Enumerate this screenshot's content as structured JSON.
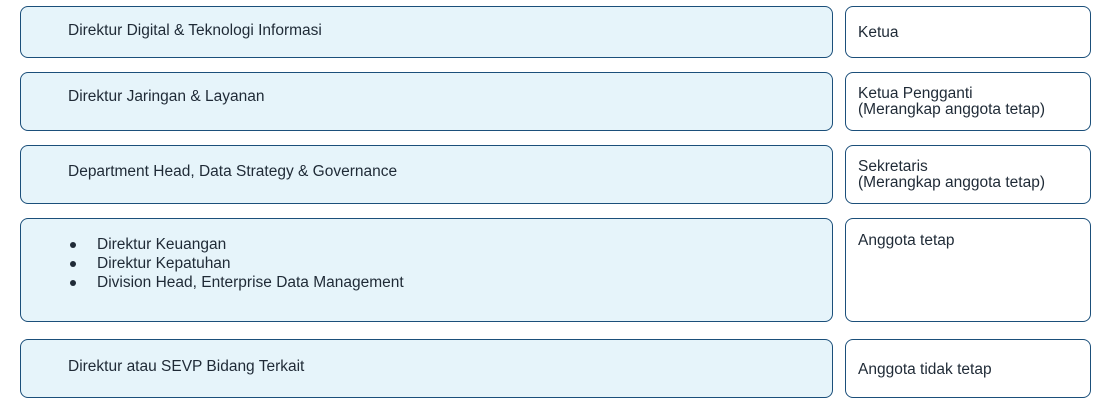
{
  "rows": [
    {
      "member": "Direktur Digital & Teknologi Informasi",
      "role_line1": "Ketua",
      "role_line2": ""
    },
    {
      "member": "Direktur Jaringan & Layanan",
      "role_line1": "Ketua Pengganti",
      "role_line2": "(Merangkap anggota tetap)"
    },
    {
      "member": "Department Head, Data Strategy & Governance",
      "role_line1": "Sekretaris",
      "role_line2": "(Merangkap anggota tetap)"
    },
    {
      "members": [
        "Direktur Keuangan",
        "Direktur Kepatuhan",
        "Division Head, Enterprise Data Management"
      ],
      "role_line1": "Anggota tetap"
    },
    {
      "member": "Direktur atau SEVP Bidang Terkait",
      "role_line1": "Anggota tidak tetap"
    }
  ]
}
